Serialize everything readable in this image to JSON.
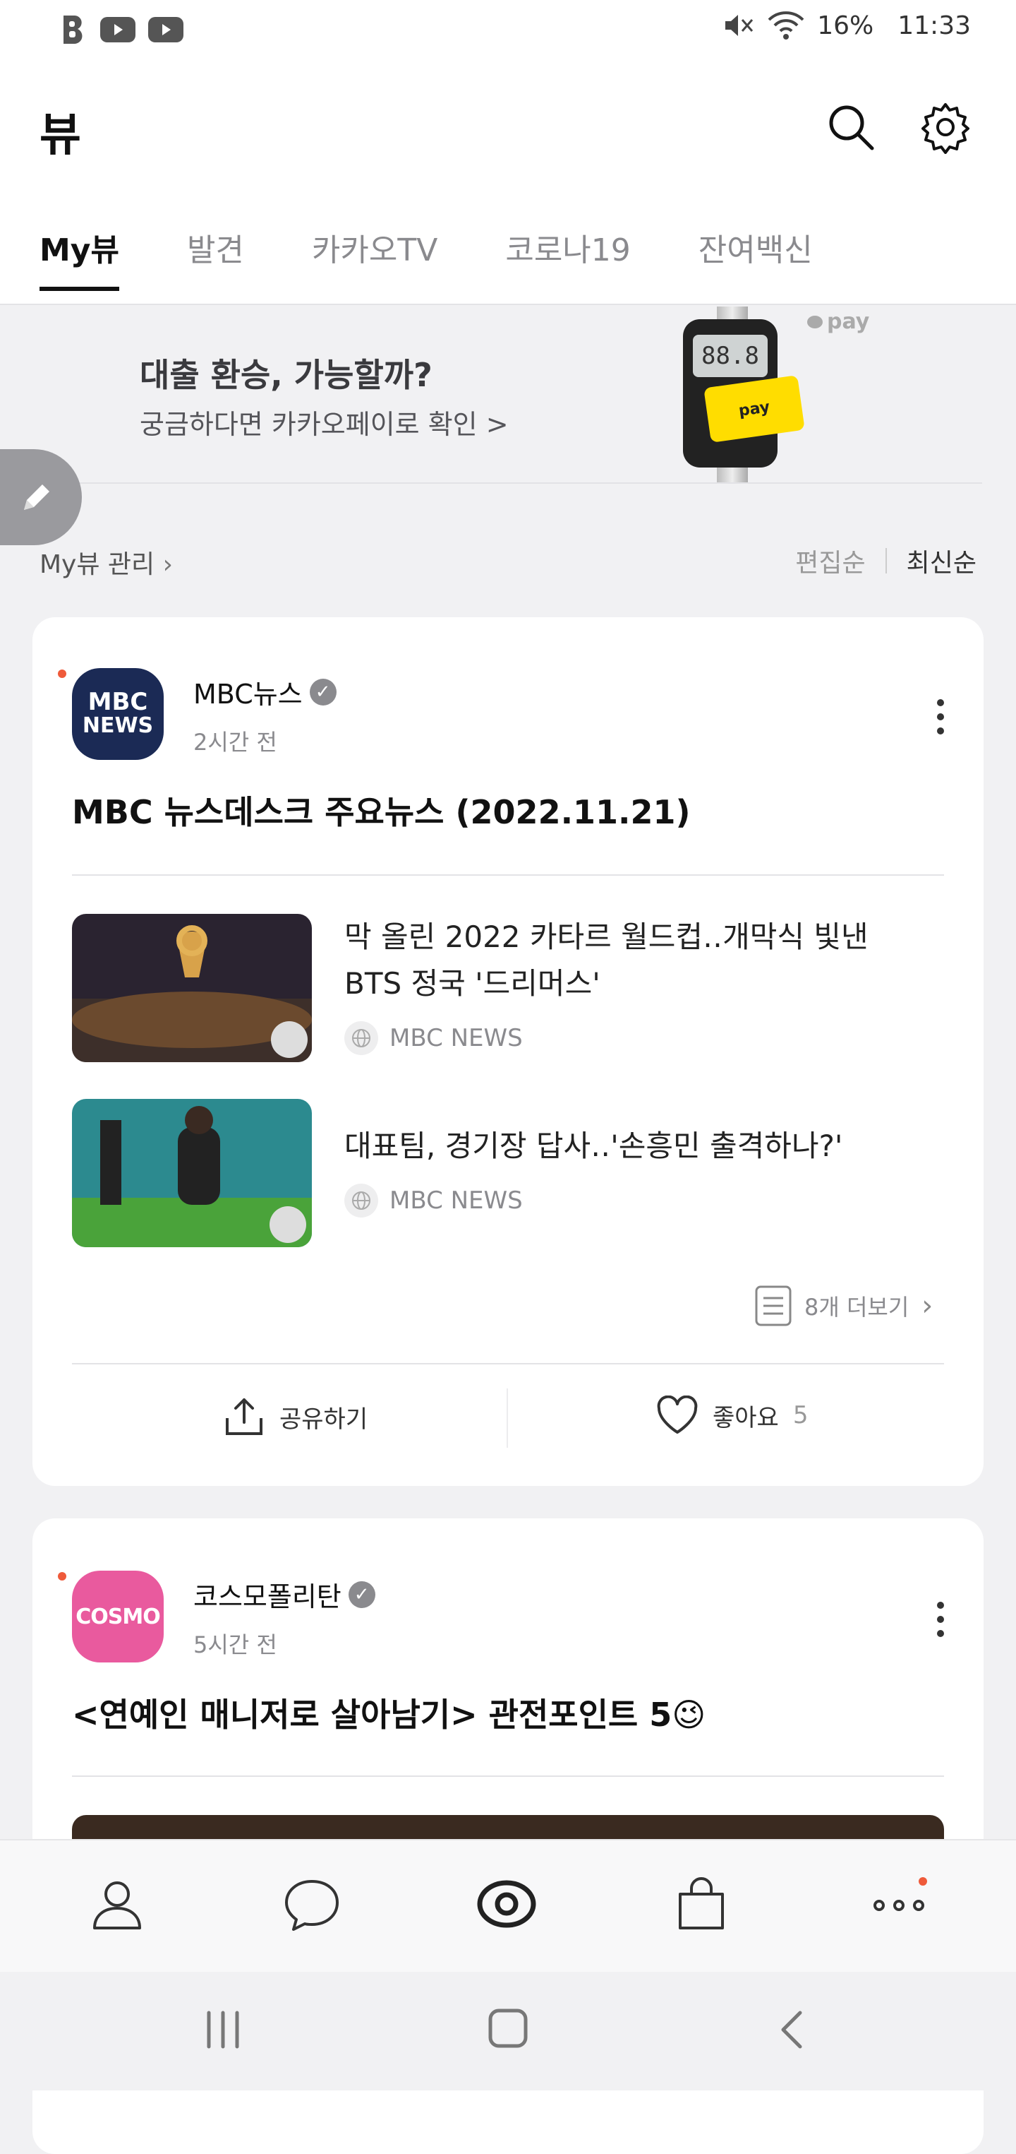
{
  "status_bar": {
    "battery": "16%",
    "time": "11:33",
    "icons": [
      "b-icon",
      "youtube-icon",
      "youtube-icon",
      "mute-icon",
      "wifi-icon"
    ]
  },
  "header": {
    "title": "뷰",
    "icons": [
      "search-icon",
      "gear-icon"
    ]
  },
  "tabs": [
    {
      "label": "My뷰",
      "active": true
    },
    {
      "label": "발견",
      "active": false
    },
    {
      "label": "카카오TV",
      "active": false
    },
    {
      "label": "코로나19",
      "active": false
    },
    {
      "label": "잔여백신",
      "active": false
    }
  ],
  "banner": {
    "title": "대출 환승, 가능할까?",
    "subtitle": "궁금하다면 카카오페이로 확인 >",
    "pay_label": "pay",
    "display_value": "88.8",
    "card_label": "pay"
  },
  "manage": {
    "label": "My뷰 관리",
    "sort_options": [
      "편집순",
      "최신순"
    ],
    "selected_sort": "최신순"
  },
  "cards": [
    {
      "publisher": "MBC뉴스",
      "avatar_text_1": "MBC",
      "avatar_text_2": "NEWS",
      "avatar_color": "#1b2a55",
      "time": "2시간 전",
      "headline": "MBC 뉴스데스크 주요뉴스 (2022.11.21)",
      "items": [
        {
          "title": "막 올린 2022 카타르 월드컵‥개막식 빛낸 BTS 정국 '드리머스'",
          "source": "MBC NEWS"
        },
        {
          "title": "대표팀, 경기장 답사‥'손흥민 출격하나?'",
          "source": "MBC NEWS"
        }
      ],
      "more_label": "8개 더보기",
      "share_label": "공유하기",
      "like_label": "좋아요",
      "like_count": "5"
    },
    {
      "publisher": "코스모폴리탄",
      "avatar_text_1": "COSMO",
      "avatar_color": "#e95a9e",
      "time": "5시간 전",
      "headline": "<연예인 매니저로 살아남기> 관전포인트 5😉"
    }
  ],
  "bottom_nav": [
    "profile-icon",
    "chat-icon",
    "view-icon",
    "shopping-icon",
    "more-icon"
  ],
  "colors": {
    "accent_dot": "#ef5a3a",
    "pay_yellow": "#ffdd00"
  }
}
